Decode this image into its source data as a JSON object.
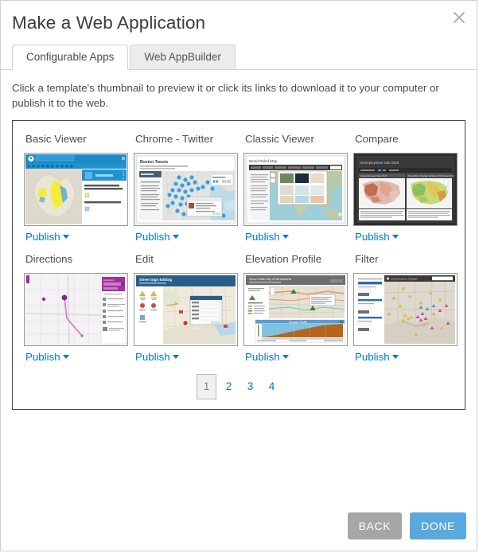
{
  "dialog": {
    "title": "Make a Web Application",
    "close_label": "close-icon"
  },
  "tabs": [
    {
      "label": "Configurable Apps",
      "active": true
    },
    {
      "label": "Web AppBuilder",
      "active": false
    }
  ],
  "description": "Click a template's thumbnail to preview it or click its links to download it to your computer or publish it to the web.",
  "templates": [
    {
      "name": "Basic Viewer",
      "publish_label": "Publish",
      "thumb": "basic-viewer"
    },
    {
      "name": "Chrome - Twitter",
      "publish_label": "Publish",
      "thumb": "chrome-twitter"
    },
    {
      "name": "Classic Viewer",
      "publish_label": "Publish",
      "thumb": "classic-viewer"
    },
    {
      "name": "Compare",
      "publish_label": "Publish",
      "thumb": "compare"
    },
    {
      "name": "Directions",
      "publish_label": "Publish",
      "thumb": "directions"
    },
    {
      "name": "Edit",
      "publish_label": "Publish",
      "thumb": "edit"
    },
    {
      "name": "Elevation Profile",
      "publish_label": "Publish",
      "thumb": "elevation-profile"
    },
    {
      "name": "Filter",
      "publish_label": "Publish",
      "thumb": "filter"
    }
  ],
  "pagination": {
    "pages": [
      "1",
      "2",
      "3",
      "4"
    ],
    "current": "1"
  },
  "footer": {
    "back_label": "BACK",
    "done_label": "DONE"
  },
  "colors": {
    "link": "#0077cc",
    "done_button": "#5ba8dd",
    "back_button": "#a6a6a6",
    "panel_border": "#444444"
  }
}
